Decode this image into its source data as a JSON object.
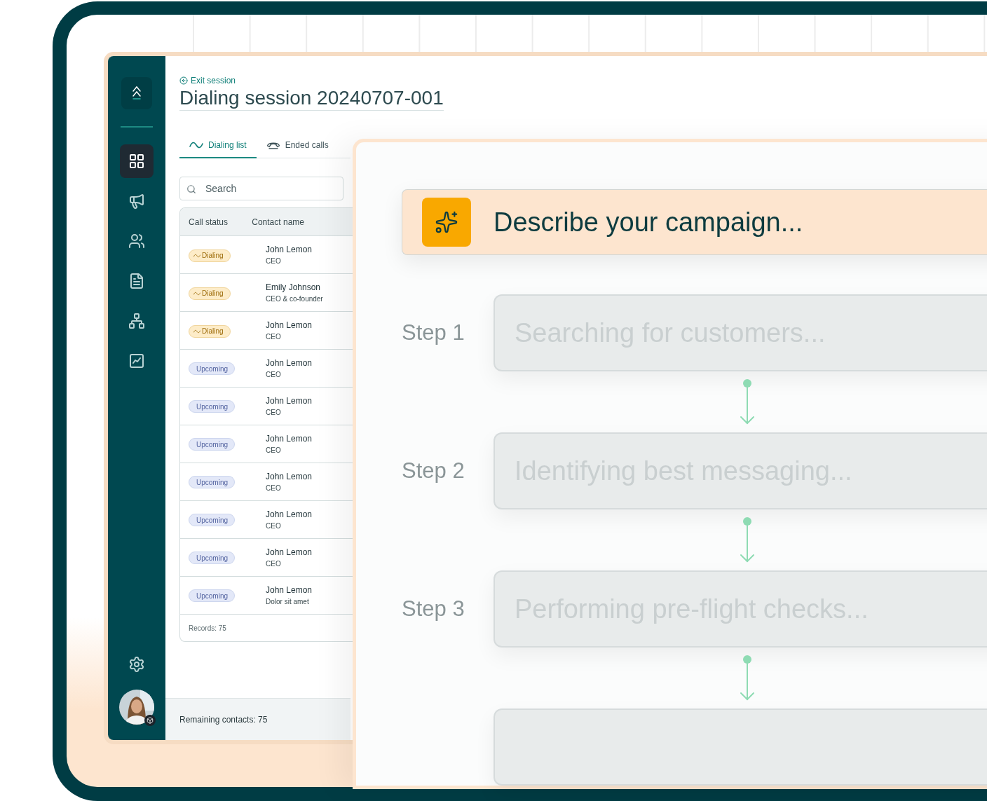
{
  "nav": [
    {
      "kind": "grid",
      "selected": true
    },
    {
      "kind": "megaphone",
      "selected": false
    },
    {
      "kind": "people",
      "selected": false
    },
    {
      "kind": "document",
      "selected": false
    },
    {
      "kind": "nodes",
      "selected": false
    },
    {
      "kind": "chart",
      "selected": false
    }
  ],
  "exit_link": "Exit session",
  "title": "Dialing session 20240707-001",
  "tabs": [
    {
      "label": "Dialing list",
      "kind": "wave",
      "selected": true
    },
    {
      "label": "Ended calls",
      "kind": "phone",
      "selected": false
    }
  ],
  "search": {
    "placeholder": "Search"
  },
  "table": {
    "columns": [
      "Call status",
      "Contact name"
    ],
    "rows": [
      {
        "status": "Dialing",
        "kind": "dialing",
        "name": "John Lemon",
        "role": "CEO"
      },
      {
        "status": "Dialing",
        "kind": "dialing",
        "name": "Emily Johnson",
        "role": "CEO & co-founder"
      },
      {
        "status": "Dialing",
        "kind": "dialing",
        "name": "John Lemon",
        "role": "CEO"
      },
      {
        "status": "Upcoming",
        "kind": "upcoming",
        "name": "John Lemon",
        "role": "CEO"
      },
      {
        "status": "Upcoming",
        "kind": "upcoming",
        "name": "John Lemon",
        "role": "CEO"
      },
      {
        "status": "Upcoming",
        "kind": "upcoming",
        "name": "John Lemon",
        "role": "CEO"
      },
      {
        "status": "Upcoming",
        "kind": "upcoming",
        "name": "John Lemon",
        "role": "CEO"
      },
      {
        "status": "Upcoming",
        "kind": "upcoming",
        "name": "John Lemon",
        "role": "CEO"
      },
      {
        "status": "Upcoming",
        "kind": "upcoming",
        "name": "John Lemon",
        "role": "CEO"
      },
      {
        "status": "Upcoming",
        "kind": "upcoming",
        "name": "John Lemon",
        "role": "Dolor sit amet"
      }
    ],
    "records": "Records: 75"
  },
  "remaining": "Remaining contacts: 75",
  "campaign": {
    "prompt": "Describe your campaign..."
  },
  "steps": [
    {
      "kind": "labeled",
      "label": "Step 1",
      "text": "Searching for customers..."
    },
    {
      "kind": "labeled",
      "label": "Step 2",
      "text": "Identifying best messaging..."
    },
    {
      "kind": "labeled",
      "label": "Step 3",
      "text": "Performing pre-flight checks..."
    },
    {
      "kind": "blank"
    }
  ]
}
